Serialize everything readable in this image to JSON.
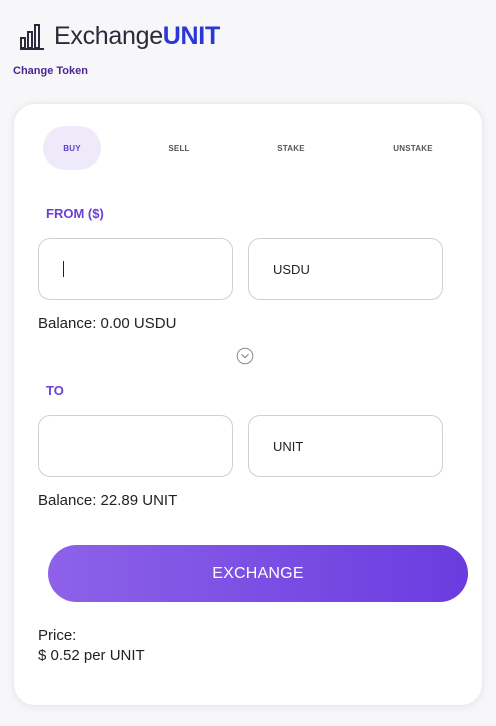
{
  "header": {
    "brand_prefix": "Exchange",
    "brand_accent": "UNIT",
    "logo_icon": "bar-chart-icon",
    "change_token": "Change Token"
  },
  "tabs": [
    {
      "label": "BUY",
      "active": true
    },
    {
      "label": "SELL",
      "active": false
    },
    {
      "label": "STAKE",
      "active": false
    },
    {
      "label": "UNSTAKE",
      "active": false
    }
  ],
  "from": {
    "label": "FROM ($)",
    "amount_value": "",
    "token": "USDU",
    "balance": "Balance: 0.00 USDU"
  },
  "swap_icon": "chevron-down-circle-icon",
  "to": {
    "label": "TO",
    "amount_value": "",
    "token": "UNIT",
    "balance": "Balance: 22.89 UNIT"
  },
  "exchange_button": "EXCHANGE",
  "price": {
    "label": "Price:",
    "value": "$ 0.52 per UNIT"
  },
  "colors": {
    "accent": "#6a3fd8",
    "brand_accent": "#2b38d8",
    "button_gradient_start": "#8d62e8",
    "button_gradient_end": "#6a3ce0",
    "active_tab_bg": "#eeeaf9"
  }
}
